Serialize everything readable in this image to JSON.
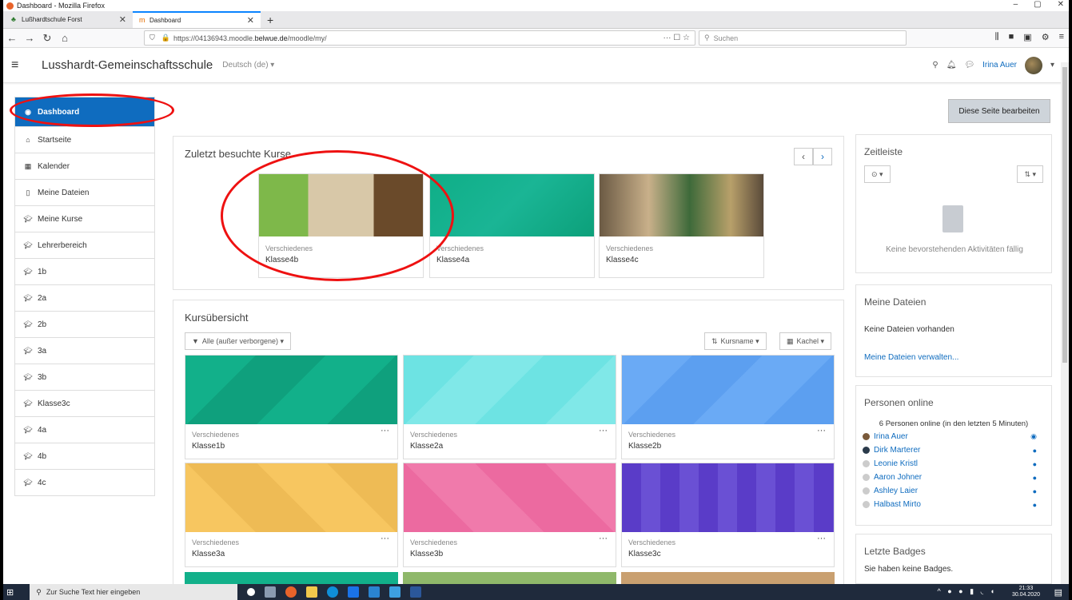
{
  "window": {
    "title": "Dashboard - Mozilla Firefox",
    "controls": [
      "–",
      "▢",
      "✕"
    ]
  },
  "tabs": [
    {
      "label": "Lußhardtschule Forst",
      "active": false
    },
    {
      "label": "Dashboard",
      "active": true
    }
  ],
  "nav": {
    "url_prefix": "https://04136943.moodle.",
    "url_domain": "belwue.de",
    "url_suffix": "/moodle/my/",
    "url_more": "··· ☐ ☆",
    "search_placeholder": "Suchen"
  },
  "header": {
    "site_name": "Lusshardt-Gemeinschaftsschule",
    "language": "Deutsch (de) ▾",
    "user_name": "Irina Auer"
  },
  "sidebar": {
    "items": [
      {
        "label": "Dashboard",
        "icon": "dashboard-icon",
        "active": true
      },
      {
        "label": "Startseite",
        "icon": "home-icon"
      },
      {
        "label": "Kalender",
        "icon": "calendar-icon"
      },
      {
        "label": "Meine Dateien",
        "icon": "file-icon"
      },
      {
        "label": "Meine Kurse",
        "icon": "graduation-cap-icon"
      },
      {
        "label": "Lehrerbereich",
        "icon": "graduation-cap-icon"
      },
      {
        "label": "1b",
        "icon": "graduation-cap-icon"
      },
      {
        "label": "2a",
        "icon": "graduation-cap-icon"
      },
      {
        "label": "2b",
        "icon": "graduation-cap-icon"
      },
      {
        "label": "3a",
        "icon": "graduation-cap-icon"
      },
      {
        "label": "3b",
        "icon": "graduation-cap-icon"
      },
      {
        "label": "Klasse3c",
        "icon": "graduation-cap-icon"
      },
      {
        "label": "4a",
        "icon": "graduation-cap-icon"
      },
      {
        "label": "4b",
        "icon": "graduation-cap-icon"
      },
      {
        "label": "4c",
        "icon": "graduation-cap-icon"
      }
    ]
  },
  "edit_button": "Diese Seite bearbeiten",
  "recent": {
    "title": "Zuletzt besuchte Kurse",
    "courses": [
      {
        "category": "Verschiedenes",
        "name": "Klasse4b",
        "color": "#6aa84f"
      },
      {
        "category": "Verschiedenes",
        "name": "Klasse4a",
        "color": "#0fae87"
      },
      {
        "category": "Verschiedenes",
        "name": "Klasse4c",
        "color": "#7a6a55"
      }
    ]
  },
  "overview": {
    "title": "Kursübersicht",
    "filter": "Alle (außer verborgene) ▾",
    "sort": "Kursname ▾",
    "view": "Kachel ▾",
    "courses": [
      {
        "category": "Verschiedenes",
        "name": "Klasse1b",
        "color": "#12b08a"
      },
      {
        "category": "Verschiedenes",
        "name": "Klasse2a",
        "color": "#6de3e3"
      },
      {
        "category": "Verschiedenes",
        "name": "Klasse2b",
        "color": "#6aaaf5"
      },
      {
        "category": "Verschiedenes",
        "name": "Klasse3a",
        "color": "#f7c660"
      },
      {
        "category": "Verschiedenes",
        "name": "Klasse3b",
        "color": "#ec6aa0"
      },
      {
        "category": "Verschiedenes",
        "name": "Klasse3c",
        "color": "#5a3cc8"
      }
    ]
  },
  "timeline": {
    "title": "Zeitleiste",
    "empty": "Keine bevorstehenden Aktivitäten fällig"
  },
  "files": {
    "title": "Meine Dateien",
    "empty": "Keine Dateien vorhanden",
    "manage": "Meine Dateien verwalten..."
  },
  "online": {
    "title": "Personen online",
    "summary": "6 Personen online (in den letzten 5 Minuten)",
    "people": [
      "Irina Auer",
      "Dirk Marterer",
      "Leonie Kristl",
      "Aaron Johner",
      "Ashley Laier",
      "Halbast Mirto"
    ]
  },
  "badges": {
    "title": "Letzte Badges",
    "empty": "Sie haben keine Badges."
  },
  "taskbar": {
    "search": "Zur Suche Text hier eingeben",
    "time": "21:33",
    "date": "30.04.2020"
  }
}
